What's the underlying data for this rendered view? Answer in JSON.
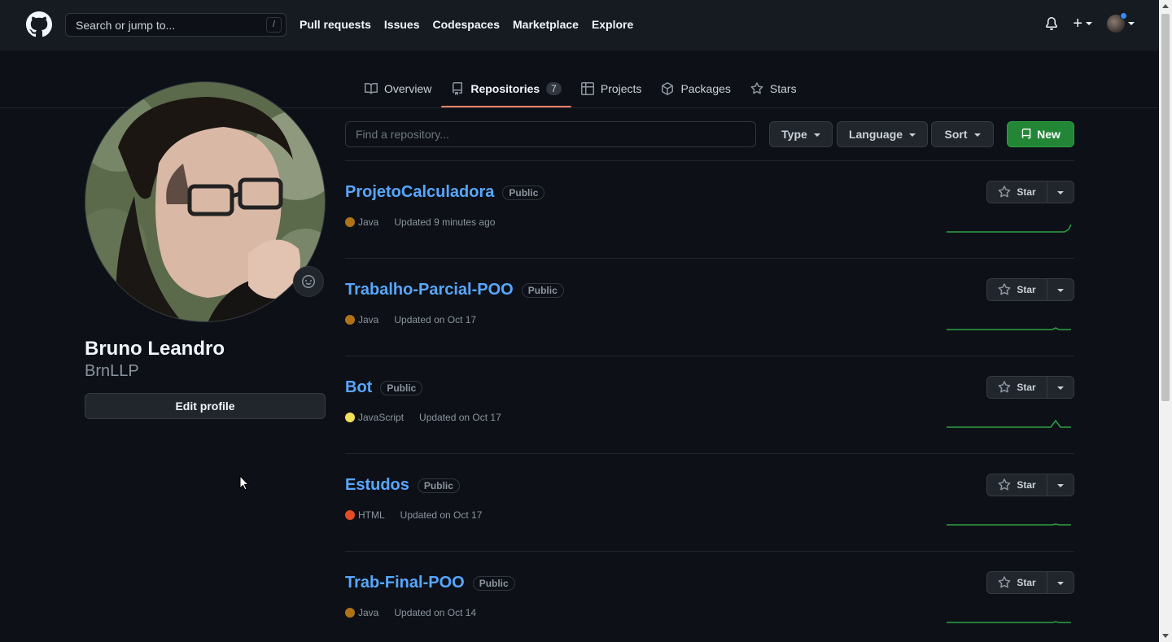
{
  "header": {
    "logo_icon": "github-mark-icon",
    "search_placeholder": "Search or jump to...",
    "search_shortcut": "/",
    "nav": [
      "Pull requests",
      "Issues",
      "Codespaces",
      "Marketplace",
      "Explore"
    ],
    "plus_label": "+"
  },
  "tabs": [
    {
      "label": "Overview",
      "icon": "book-icon"
    },
    {
      "label": "Repositories",
      "icon": "repo-icon",
      "count": "7",
      "active": true
    },
    {
      "label": "Projects",
      "icon": "table-icon"
    },
    {
      "label": "Packages",
      "icon": "package-icon"
    },
    {
      "label": "Stars",
      "icon": "star-icon"
    }
  ],
  "profile": {
    "name": "Bruno Leandro",
    "login": "BrnLLP",
    "edit_label": "Edit profile"
  },
  "filters": {
    "find_placeholder": "Find a repository...",
    "type_label": "Type",
    "language_label": "Language",
    "sort_label": "Sort",
    "new_label": "New"
  },
  "repos": [
    {
      "name": "ProjetoCalculadora",
      "visibility": "Public",
      "language": "Java",
      "lang_color": "#b07219",
      "updated": "Updated 9 minutes ago",
      "star_label": "Star"
    },
    {
      "name": "Trabalho-Parcial-POO",
      "visibility": "Public",
      "language": "Java",
      "lang_color": "#b07219",
      "updated": "Updated on Oct 17",
      "star_label": "Star"
    },
    {
      "name": "Bot",
      "visibility": "Public",
      "language": "JavaScript",
      "lang_color": "#f1e05a",
      "updated": "Updated on Oct 17",
      "star_label": "Star"
    },
    {
      "name": "Estudos",
      "visibility": "Public",
      "language": "HTML",
      "lang_color": "#e34c26",
      "updated": "Updated on Oct 17",
      "star_label": "Star"
    },
    {
      "name": "Trab-Final-POO",
      "visibility": "Public",
      "language": "Java",
      "lang_color": "#b07219",
      "updated": "Updated on Oct 14",
      "star_label": "Star"
    }
  ],
  "colors": {
    "accent_tab": "#f78166",
    "link": "#58a6ff",
    "new_button": "#238636",
    "sparkline": "#2ea043"
  }
}
